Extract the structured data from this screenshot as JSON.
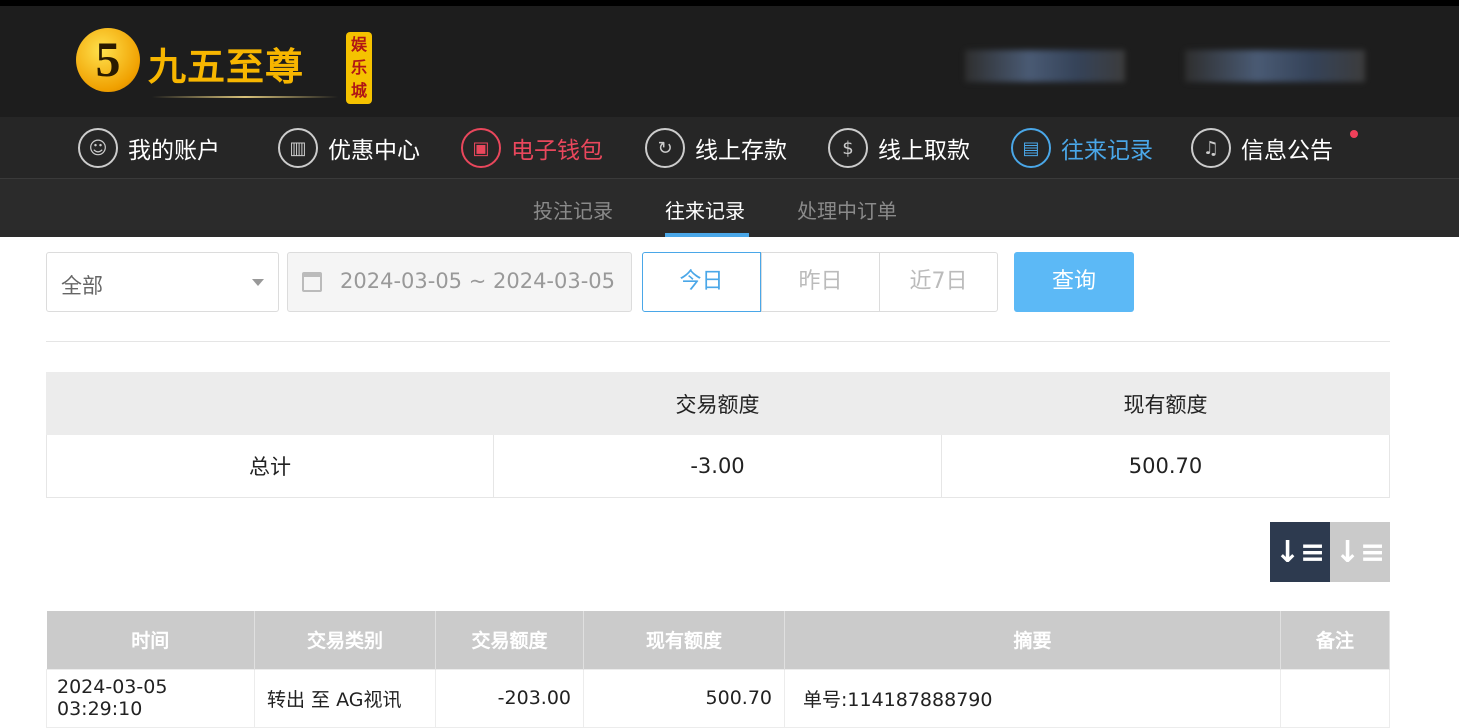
{
  "logo": {
    "digit": "5",
    "name": "九五至尊",
    "badge": "娱乐城"
  },
  "nav": [
    {
      "label": "我的账户",
      "icon": "user-icon",
      "glyph": "☺"
    },
    {
      "label": "优惠中心",
      "icon": "gift-icon",
      "glyph": "▥"
    },
    {
      "label": "电子钱包",
      "icon": "wallet-icon",
      "glyph": "▣"
    },
    {
      "label": "线上存款",
      "icon": "deposit-icon",
      "glyph": "↻"
    },
    {
      "label": "线上取款",
      "icon": "withdraw-icon",
      "glyph": "$"
    },
    {
      "label": "往来记录",
      "icon": "records-icon",
      "glyph": "▤"
    },
    {
      "label": "信息公告",
      "icon": "bell-icon",
      "glyph": "♫"
    }
  ],
  "subnav": [
    "投注记录",
    "往来记录",
    "处理中订单"
  ],
  "filter": {
    "type": "全部",
    "date_range": "2024-03-05 ~ 2024-03-05",
    "today": "今日",
    "yesterday": "昨日",
    "last7": "近7日",
    "search": "查询"
  },
  "summary": {
    "headers": [
      "",
      "交易额度",
      "现有额度"
    ],
    "row": [
      "总计",
      "-3.00",
      "500.70"
    ]
  },
  "detail": {
    "headers": [
      "时间",
      "交易类别",
      "交易额度",
      "现有额度",
      "摘要",
      "备注"
    ],
    "rows": [
      [
        "2024-03-05 03:29:10",
        "转出 至 AG视讯",
        "-203.00",
        "500.70",
        "单号:114187888790",
        ""
      ]
    ]
  }
}
